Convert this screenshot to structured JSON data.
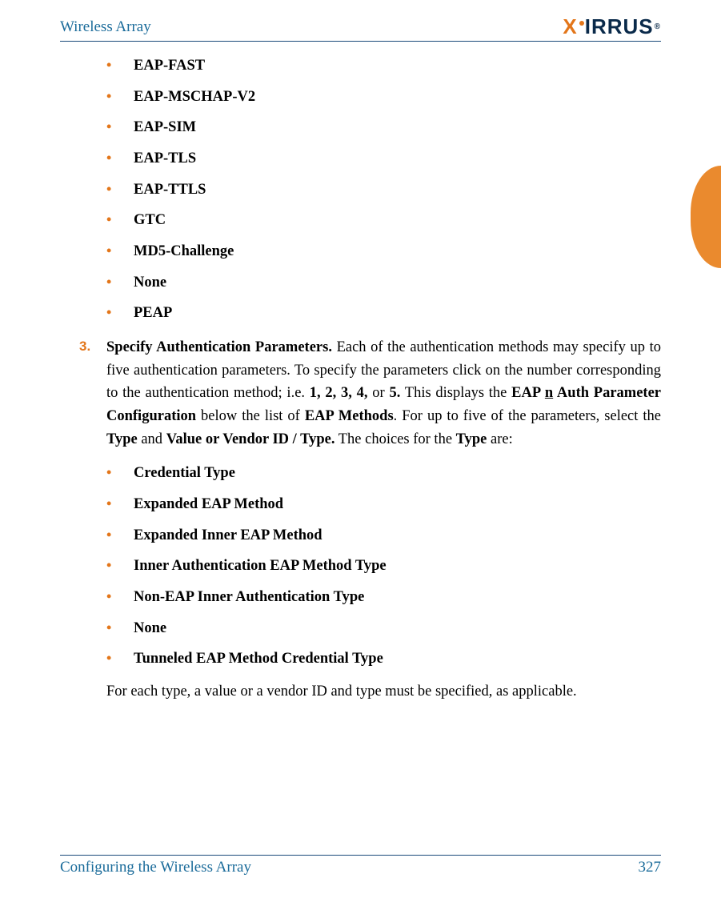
{
  "header": {
    "title": "Wireless Array",
    "logo_text": "IRRUS"
  },
  "methods": [
    "EAP-FAST",
    "EAP-MSCHAP-V2",
    "EAP-SIM",
    "EAP-TLS",
    "EAP-TTLS",
    "GTC",
    "MD5-Challenge",
    "None",
    "PEAP"
  ],
  "step": {
    "number": "3.",
    "lead": "Specify Authentication Parameters.",
    "body_1": " Each of the authentication methods may specify up to five authentication parameters. To specify the parameters click on the number corresponding to the authentication method; i.e. ",
    "numbers": "1, 2, 3, 4,",
    "or": " or ",
    "five": "5.",
    "body_2": " This displays the ",
    "eap_n": "EAP ",
    "eap_n_u": "n",
    "eap_suffix": " Auth Parameter Configuration",
    "body_3": " below the list of ",
    "eap_methods": "EAP Methods",
    "body_4": ". For up to five of the parameters, select the ",
    "type_word": "Type",
    "and": " and ",
    "value_vendor": "Value or Vendor ID / Type.",
    "body_5": " The choices for the ",
    "type_word2": "Type",
    "body_6": " are:"
  },
  "types": [
    "Credential Type",
    "Expanded EAP Method",
    "Expanded Inner EAP Method",
    "Inner Authentication EAP Method Type",
    "Non-EAP Inner Authentication Type",
    "None",
    "Tunneled EAP Method Credential Type"
  ],
  "closing": "For each type, a value or a vendor ID and type must be specified, as applicable.",
  "footer": {
    "section": "Configuring the Wireless Array",
    "page": "327"
  }
}
